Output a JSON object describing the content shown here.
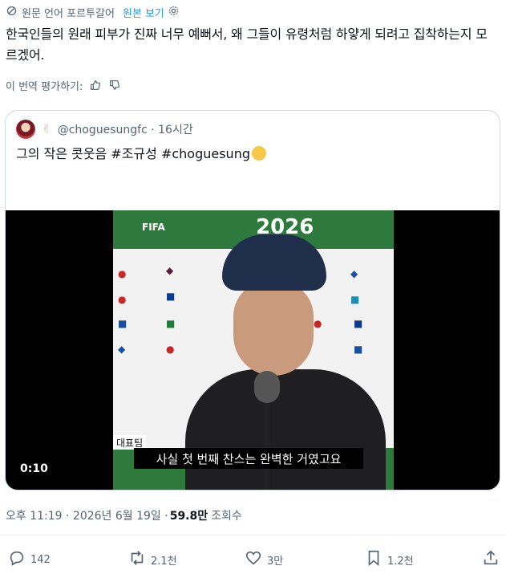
{
  "translation": {
    "label": "원문 언어 포르투갈어",
    "original_link": "원본 보기"
  },
  "tweet": {
    "text": "한국인들의 원래 피부가 진짜 너무 예뻐서, 왜 그들이 유령처럼 하얗게 되려고 집착하는지 모르겠어.",
    "rate_label": "이 번역 평가하기:"
  },
  "quote": {
    "handle": "@choguesungfc · 16시간",
    "text": "그의 작은 콧웃음 #조규성 #choguesung",
    "video": {
      "backdrop_year": "2026",
      "backdrop_fifa": "FIFA",
      "team_tag": "대표팀",
      "subtitle": "사실 첫 번째 찬스는 완벽한 거였고요",
      "time": "0:10"
    }
  },
  "meta": {
    "datetime": "오후 11:19 · 2026년 6월 19일 · ",
    "views": "59.8만",
    "views_label": "조회수"
  },
  "actions": {
    "reply_count": "142",
    "retweet_count": "2.1천",
    "like_count": "3만",
    "bookmark_count": "1.2천"
  },
  "colors": {
    "accent": "#1d9bf0",
    "secondary_text": "#536471",
    "border": "#cfd9de"
  }
}
